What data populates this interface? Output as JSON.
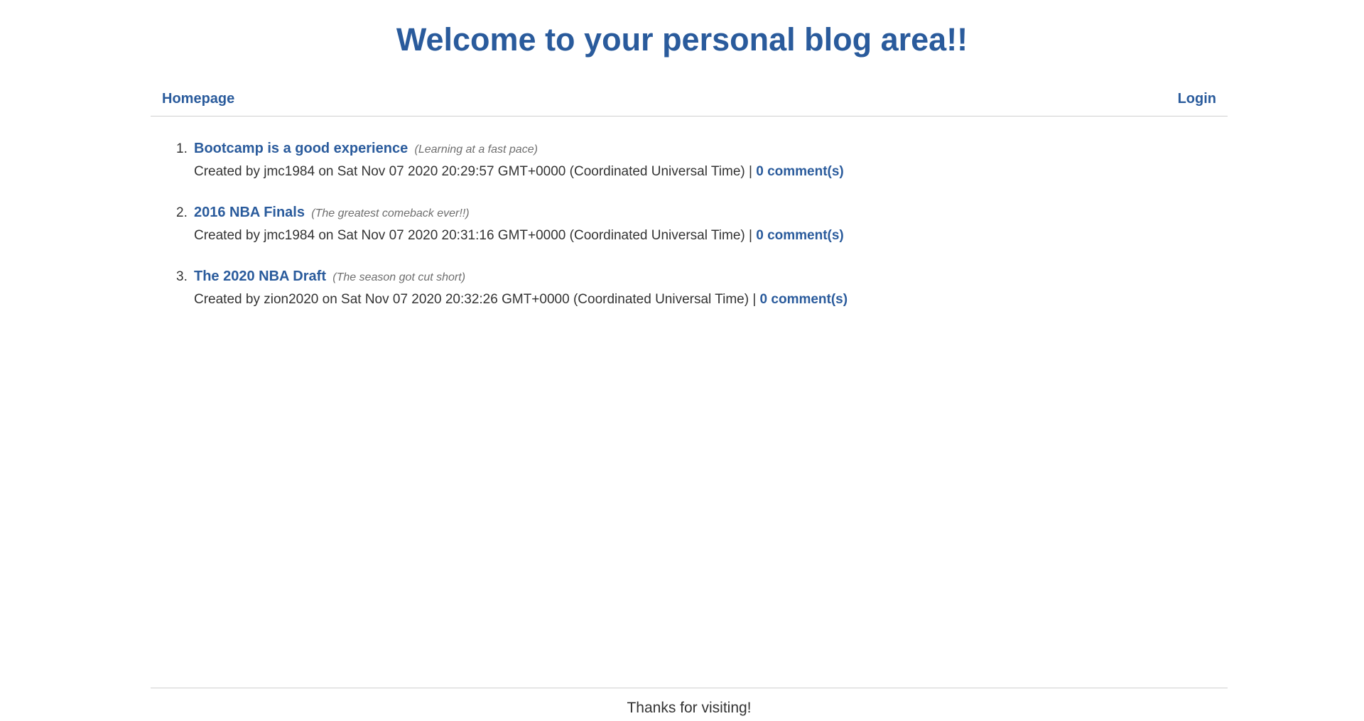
{
  "header": {
    "title": "Welcome to your personal blog area!!"
  },
  "nav": {
    "home_label": "Homepage",
    "login_label": "Login"
  },
  "posts": [
    {
      "number": "1.",
      "title": "Bootcamp is a good experience",
      "subtitle": "(Learning at a fast pace)",
      "meta": "Created by jmc1984 on Sat Nov 07 2020 20:29:57 GMT+0000 (Coordinated Universal Time) |",
      "comments_label": "0 comment(s)"
    },
    {
      "number": "2.",
      "title": "2016 NBA Finals",
      "subtitle": "(The greatest comeback ever!!)",
      "meta": "Created by jmc1984 on Sat Nov 07 2020 20:31:16 GMT+0000 (Coordinated Universal Time) |",
      "comments_label": "0 comment(s)"
    },
    {
      "number": "3.",
      "title": "The 2020 NBA Draft",
      "subtitle": "(The season got cut short)",
      "meta": "Created by zion2020 on Sat Nov 07 2020 20:32:26 GMT+0000 (Coordinated Universal Time) |",
      "comments_label": "0 comment(s)"
    }
  ],
  "footer": {
    "text": "Thanks for visiting!"
  },
  "colors": {
    "accent": "#2a5b9c",
    "text": "#333333",
    "muted": "#6e6e6e",
    "divider": "#cfcfcf"
  }
}
